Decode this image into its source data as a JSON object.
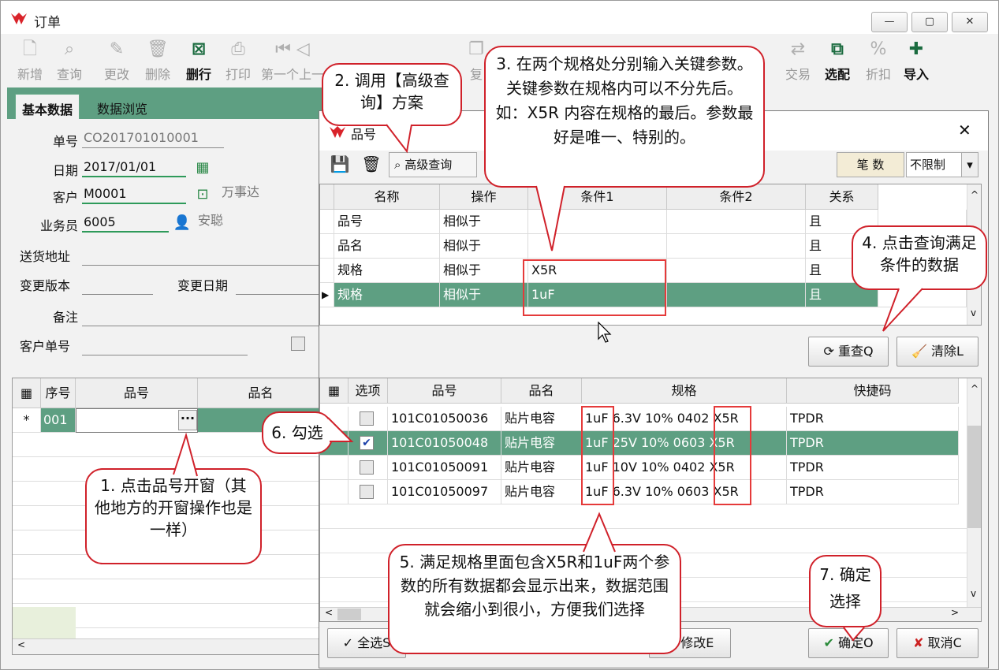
{
  "window": {
    "title": "订单",
    "controls": [
      "—",
      "▢",
      "✕"
    ]
  },
  "toolbar": [
    {
      "label": "新增",
      "icon": "new-doc-icon",
      "enabled": false
    },
    {
      "label": "查询",
      "icon": "search-icon",
      "enabled": false
    },
    {
      "label": "更改",
      "icon": "pencil-icon",
      "enabled": false
    },
    {
      "label": "删除",
      "icon": "trash-icon",
      "enabled": false
    },
    {
      "label": "删行",
      "icon": "delete-row-icon",
      "enabled": true
    },
    {
      "label": "打印",
      "icon": "printer-icon",
      "enabled": false
    },
    {
      "label": "第一个上一",
      "icon": "first-record-icon",
      "enabled": false
    },
    {
      "label": "复",
      "icon": "copy-icon",
      "enabled": false
    },
    {
      "label": "交易",
      "icon": "handshake-icon",
      "enabled": false
    },
    {
      "label": "选配",
      "icon": "match-icon",
      "enabled": true
    },
    {
      "label": "折扣",
      "icon": "discount-icon",
      "enabled": false
    },
    {
      "label": "导入",
      "icon": "import-icon",
      "enabled": true
    }
  ],
  "tabs": [
    "基本数据",
    "数据浏览"
  ],
  "form": {
    "order_no_label": "单号",
    "order_no": "CO201701010001",
    "date_label": "日期",
    "date": "2017/01/01",
    "customer_label": "客户",
    "customer": "M0001",
    "customer_name": "万事达",
    "sales_label": "业务员",
    "sales": "6005",
    "sales_name": "安聪",
    "address_label": "送货地址",
    "version_label": "变更版本",
    "change_date_label": "变更日期",
    "remark_label": "备注",
    "cust_order_label": "客户单号"
  },
  "left_grid": {
    "headers": [
      "序号",
      "品号",
      "品名"
    ],
    "row_marker": "*",
    "seq": "001",
    "ellipsis": "···"
  },
  "dialog": {
    "title": "品号",
    "adv_query_label": "高级查询",
    "count_label": "笔 数",
    "limit_value": "不限制",
    "query_headers": [
      "名称",
      "操作",
      "条件1",
      "条件2",
      "关系"
    ],
    "query_rows": [
      {
        "name": "品号",
        "op": "相似于",
        "c1": "",
        "c2": "",
        "rel": "且"
      },
      {
        "name": "品名",
        "op": "相似于",
        "c1": "",
        "c2": "",
        "rel": "且"
      },
      {
        "name": "规格",
        "op": "相似于",
        "c1": "X5R",
        "c2": "",
        "rel": "且"
      },
      {
        "name": "规格",
        "op": "相似于",
        "c1": "1uF",
        "c2": "",
        "rel": "且"
      }
    ],
    "requery_label": "重查Q",
    "clear_label": "清除L",
    "result_headers": [
      "选项",
      "品号",
      "品名",
      "规格",
      "快捷码"
    ],
    "result_rows": [
      {
        "checked": false,
        "item_no": "101C01050036",
        "name": "贴片电容",
        "spec": "1uF 6.3V 10% 0402 X5R",
        "code": "TPDR"
      },
      {
        "checked": true,
        "item_no": "101C01050048",
        "name": "贴片电容",
        "spec": "1uF 25V 10% 0603 X5R",
        "code": "TPDR"
      },
      {
        "checked": false,
        "item_no": "101C01050091",
        "name": "贴片电容",
        "spec": "1uF 10V 10% 0402 X5R",
        "code": "TPDR"
      },
      {
        "checked": false,
        "item_no": "101C01050097",
        "name": "贴片电容",
        "spec": "1uF 6.3V 10% 0603 X5R",
        "code": "TPDR"
      }
    ],
    "select_all_label": "全选S",
    "modify_label": "修改E",
    "ok_label": "确定O",
    "cancel_label": "取消C"
  },
  "callouts": {
    "c1": "1.  点击品号开窗（其他地方的开窗操作也是一样）",
    "c2": "2. 调用【高级查询】方案",
    "c3": "3. 在两个规格处分别输入关键参数。关键参数在规格内可以不分先后。如：X5R 内容在规格的最后。参数最好是唯一、特别的。",
    "c4": "4. 点击查询满足条件的数据",
    "c5": "5. 满足规格里面包含X5R和1uF两个参数的所有数据都会显示出来，数据范围就会缩小到很小，方便我们选择",
    "c6": "6. 勾选",
    "c7": "7. 确定选择"
  }
}
